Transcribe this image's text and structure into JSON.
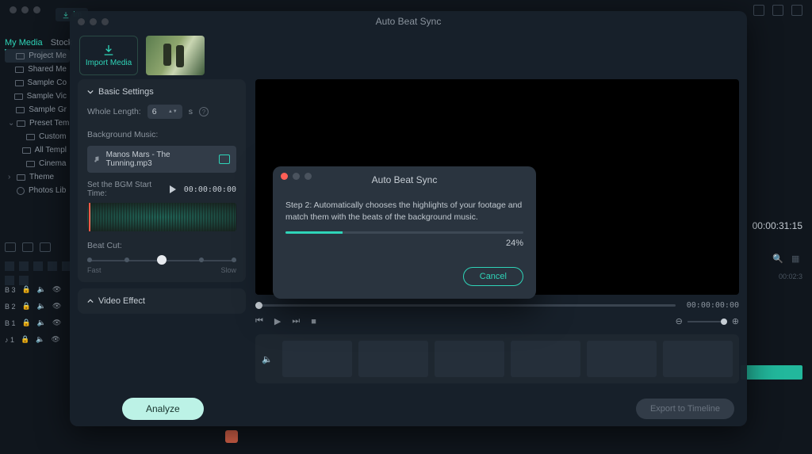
{
  "app_bg": {
    "import_pill": "Im",
    "tabs": [
      "My Media",
      "Stock"
    ],
    "sidebar": [
      {
        "label": "Project Me",
        "kind": "folder",
        "sel": true
      },
      {
        "label": "Shared Me",
        "kind": "folder"
      },
      {
        "label": "Sample Co",
        "kind": "folder"
      },
      {
        "label": "Sample Vic",
        "kind": "folder"
      },
      {
        "label": "Sample Gr",
        "kind": "folder"
      },
      {
        "label": "Preset Tem",
        "kind": "folder",
        "expand": true
      },
      {
        "label": "Custom",
        "kind": "folder",
        "indent": true
      },
      {
        "label": "All Templ",
        "kind": "folder",
        "indent": true
      },
      {
        "label": "Cinema",
        "kind": "folder",
        "indent": true
      },
      {
        "label": "Theme",
        "kind": "folder",
        "chev": true
      },
      {
        "label": "Photos Lib",
        "kind": "gear"
      }
    ],
    "timecode": "00:00:31:15",
    "tl_time": "00:02:3",
    "tracks": [
      "B 3",
      "B 2",
      "B 1",
      "♪ 1"
    ]
  },
  "abs": {
    "title": "Auto Beat Sync",
    "import_label": "Import Media",
    "settings": {
      "header": "Basic Settings",
      "whole_length_label": "Whole Length:",
      "whole_length_value": "6",
      "whole_length_unit": "s",
      "bgm_label": "Background Music:",
      "bgm_file": "Manos Mars - The Tunning.mp3",
      "bgm_start_label": "Set the BGM Start Time:",
      "bgm_start_tc": "00:00:00:00",
      "beat_cut_label": "Beat Cut:",
      "beat_fast": "Fast",
      "beat_slow": "Slow"
    },
    "video_effect_header": "Video Effect",
    "preview_tc": "00:00:00:00",
    "analyze_label": "Analyze",
    "export_label": "Export to Timeline"
  },
  "modal": {
    "title": "Auto Beat Sync",
    "desc": "Step 2: Automatically chooses the highlights of your footage and match them with the beats of the background music.",
    "percent": 24,
    "percent_label": "24%",
    "cancel": "Cancel"
  }
}
